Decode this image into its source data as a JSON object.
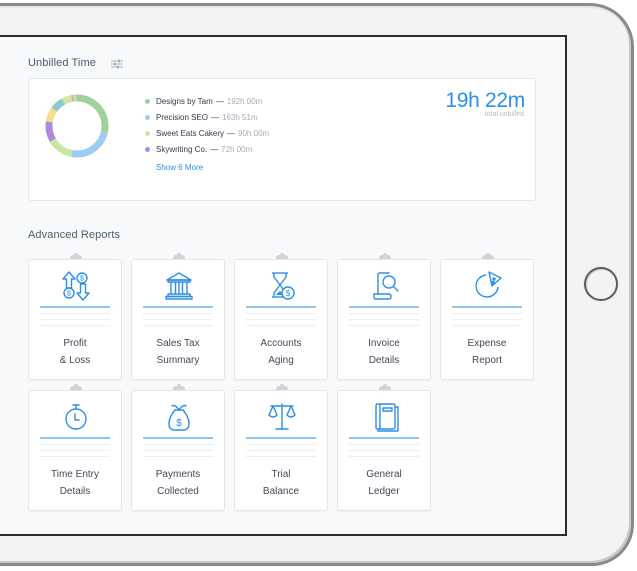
{
  "unbilled": {
    "title": "Unbilled Time",
    "filter_icon": "sliders-icon",
    "total_value": "19h 22m",
    "total_label": "total unbilled",
    "show_more_label": "Show 6 More",
    "clients": [
      {
        "name": "Designs by Tam",
        "value": "192h 00m",
        "color": "#9fd19d"
      },
      {
        "name": "Precision SEO",
        "value": "163h 51m",
        "color": "#9dccf3"
      },
      {
        "name": "Sweet Eats Cakery",
        "value": "90h 00m",
        "color": "#c6e6a2"
      },
      {
        "name": "Skywriting Co.",
        "value": "72h 00m",
        "color": "#ab8ae0"
      }
    ],
    "donut_segments": [
      {
        "label": "Designs by Tam",
        "fraction": 0.285,
        "color": "#9fd19d"
      },
      {
        "label": "Precision SEO",
        "fraction": 0.245,
        "color": "#9dccf3"
      },
      {
        "label": "Sweet Eats Cakery",
        "fraction": 0.135,
        "color": "#c6e6a2"
      },
      {
        "label": "Skywriting Co.",
        "fraction": 0.108,
        "color": "#ab8ae0"
      },
      {
        "label": "Other 1",
        "fraction": 0.075,
        "color": "#f5dd8e"
      },
      {
        "label": "Other 2",
        "fraction": 0.07,
        "color": "#8ccbc9"
      },
      {
        "label": "Other 3",
        "fraction": 0.05,
        "color": "#cfe8a8"
      },
      {
        "label": "Other 4",
        "fraction": 0.012,
        "color": "#f2a0a8"
      },
      {
        "label": "Other 5",
        "fraction": 0.012,
        "color": "#c6e6a2"
      },
      {
        "label": "Other 6",
        "fraction": 0.008,
        "color": "#9fd19d"
      }
    ]
  },
  "reports": {
    "title": "Advanced Reports",
    "accent_color": "#2d8fe6",
    "items": [
      {
        "label": "Profit\n& Loss",
        "icon": "profit-loss-arrows-icon"
      },
      {
        "label": "Sales Tax\nSummary",
        "icon": "bank-building-icon"
      },
      {
        "label": "Accounts\nAging",
        "icon": "hourglass-dollar-icon"
      },
      {
        "label": "Invoice\nDetails",
        "icon": "document-magnifier-icon"
      },
      {
        "label": "Expense\nReport",
        "icon": "pie-chart-icon"
      },
      {
        "label": "Time Entry\nDetails",
        "icon": "stopwatch-icon"
      },
      {
        "label": "Payments\nCollected",
        "icon": "money-bag-icon"
      },
      {
        "label": "Trial\nBalance",
        "icon": "scales-icon"
      },
      {
        "label": "General\nLedger",
        "icon": "ledger-book-icon"
      }
    ]
  }
}
